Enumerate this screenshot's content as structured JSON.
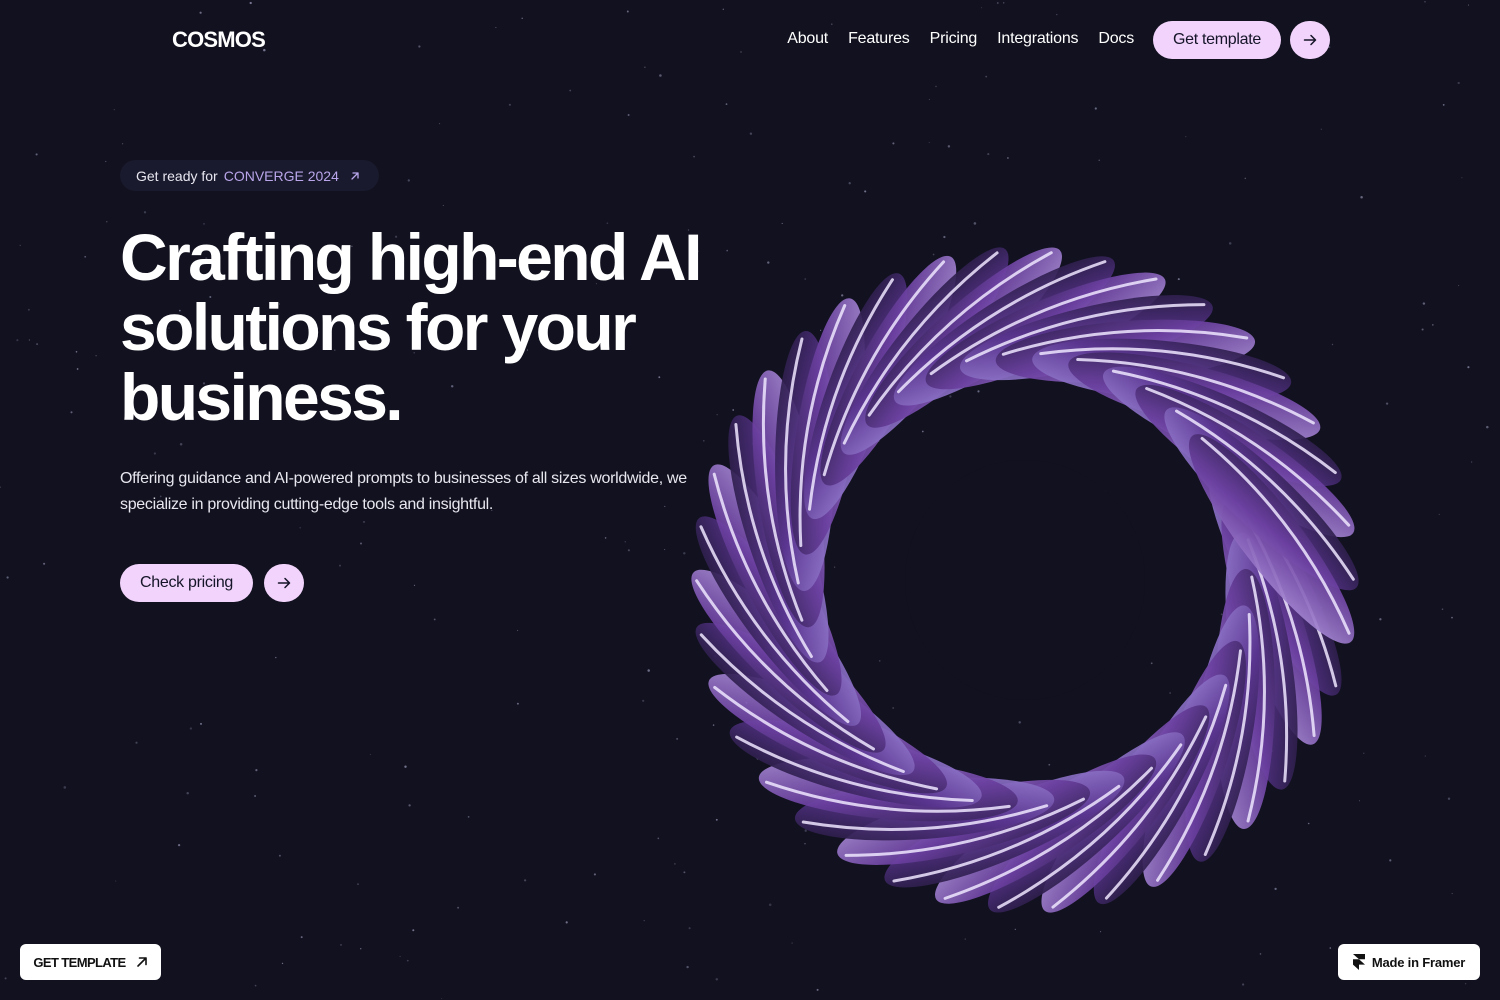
{
  "brand": {
    "logo": "COSMOS"
  },
  "nav": {
    "links": [
      "About",
      "Features",
      "Pricing",
      "Integrations",
      "Docs"
    ],
    "cta_label": "Get template",
    "cta_icon": "arrow-right-icon"
  },
  "hero": {
    "badge_lead": "Get ready for ",
    "badge_accent": "CONVERGE 2024",
    "badge_icon": "arrow-up-right-icon",
    "title_lines": [
      "Crafting high-end AI",
      "solutions for your",
      "business."
    ],
    "description": "Offering guidance and AI-powered prompts to businesses of all sizes worldwide, we specialize in providing cutting-edge tools and insightful.",
    "primary_cta": "Check pricing",
    "primary_cta_icon": "arrow-right-icon"
  },
  "footer": {
    "get_template": "GET TEMPLATE",
    "made_in": "Made in Framer"
  },
  "colors": {
    "background": "#11111f",
    "accent_pill": "#f1d3fb",
    "badge_accent": "#b9a6ea",
    "ring_purple": "#6b3fa0"
  }
}
